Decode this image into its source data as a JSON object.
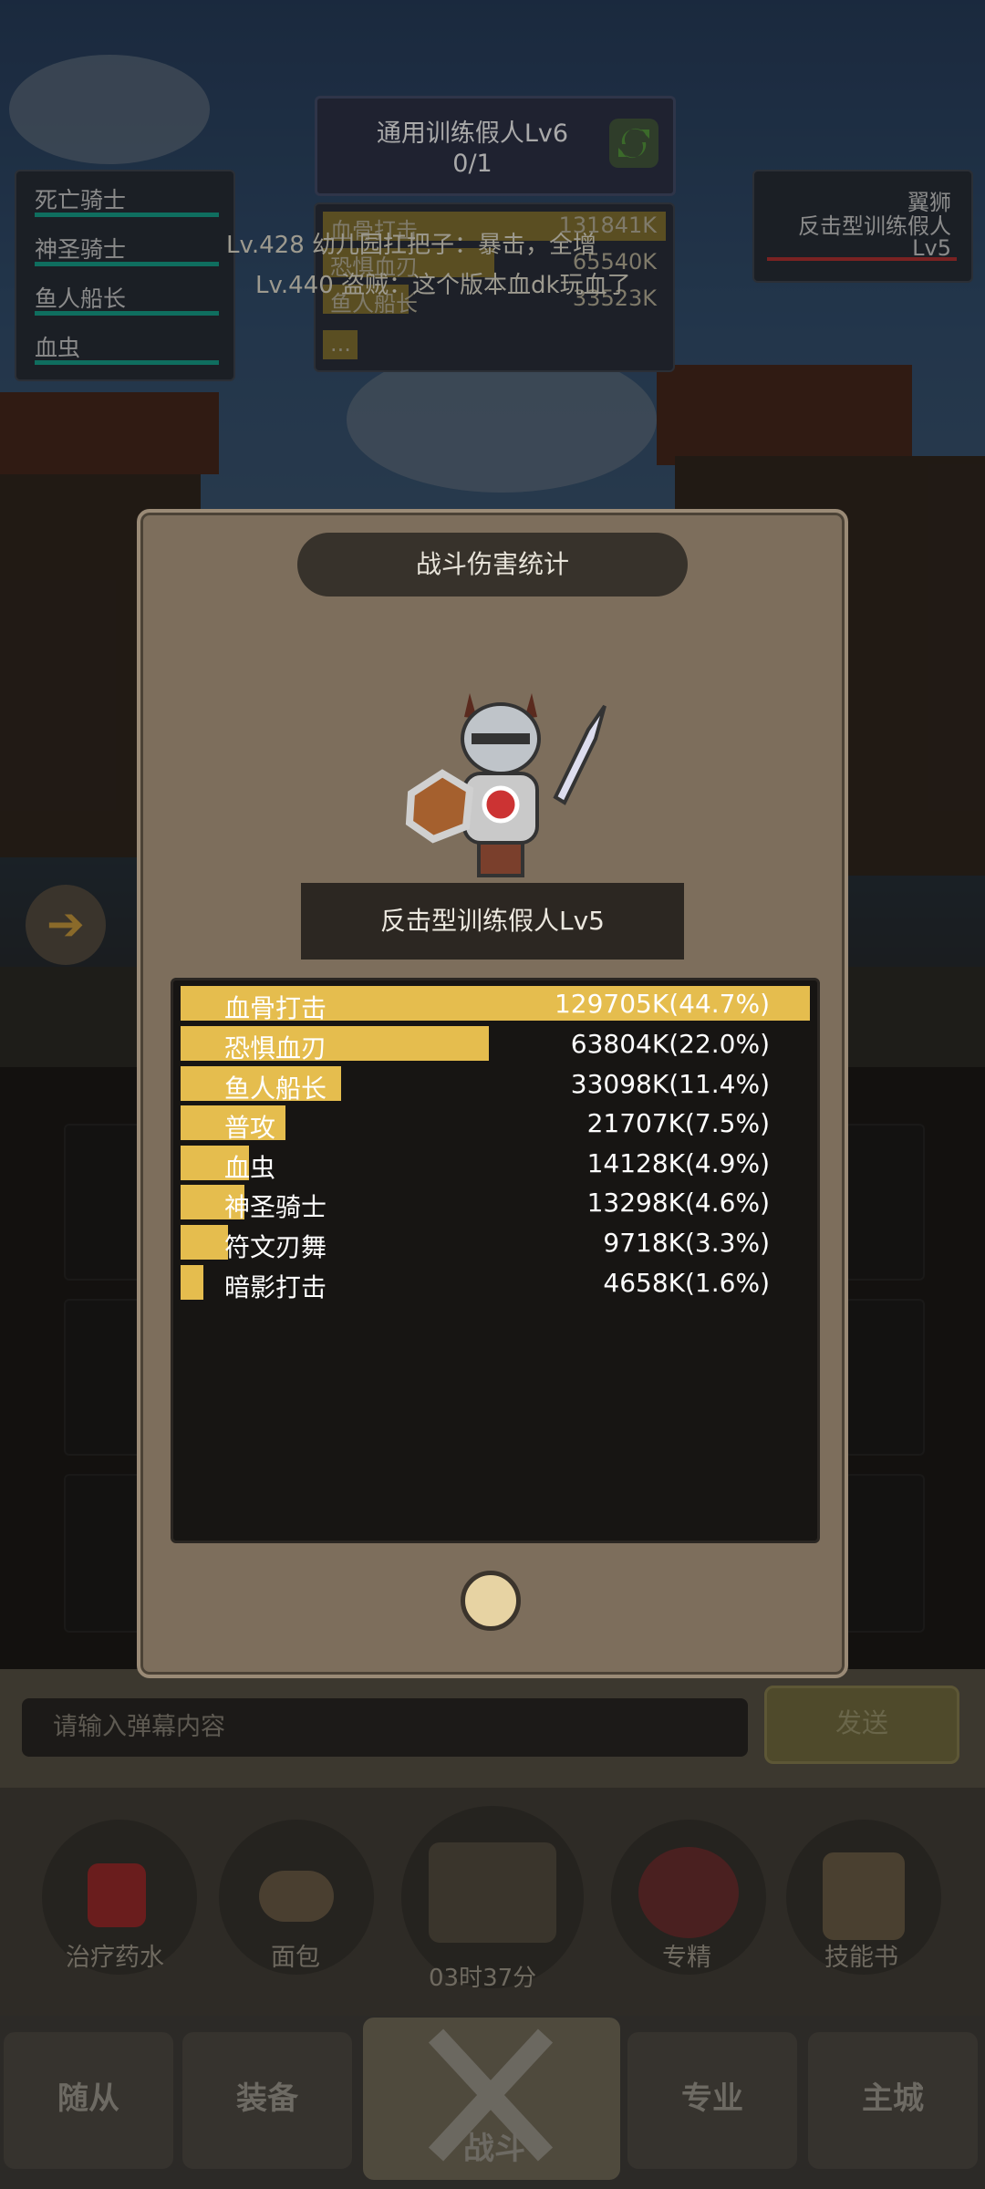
{
  "hud": {
    "target_name": "通用训练假人Lv6",
    "target_count": "0/1",
    "party": [
      {
        "label": "死亡骑士"
      },
      {
        "label": "神圣骑士"
      },
      {
        "label": "鱼人船长"
      },
      {
        "label": "血虫"
      }
    ],
    "damage_preview": [
      {
        "label": "血骨打击",
        "value": "131841K",
        "fill": 1.0
      },
      {
        "label": "恐惧血刃",
        "value": "65540K",
        "fill": 0.5
      },
      {
        "label": "鱼人船长",
        "value": "33523K",
        "fill": 0.25
      },
      {
        "label": "...",
        "value": "",
        "fill": 0.1
      }
    ],
    "enemy": {
      "name_top": "翼狮",
      "name": "反击型训练假人",
      "level": "Lv5"
    },
    "danmaku": [
      "Lv.428 幼儿园扛把子：暴击，全增",
      "Lv.440 盗贼：这个版本血dk玩血了"
    ]
  },
  "dialog": {
    "title": "战斗伤害统计",
    "target_label": "反击型训练假人Lv5",
    "rows": [
      {
        "name": "血骨打击",
        "value": "129705K(44.7%)",
        "share": 1.0
      },
      {
        "name": "恐惧血刃",
        "value": "63804K(22.0%)",
        "share": 0.49
      },
      {
        "name": "鱼人船长",
        "value": "33098K(11.4%)",
        "share": 0.255
      },
      {
        "name": "普攻",
        "value": "21707K(7.5%)",
        "share": 0.167
      },
      {
        "name": "血虫",
        "value": "14128K(4.9%)",
        "share": 0.109
      },
      {
        "name": "神圣骑士",
        "value": "13298K(4.6%)",
        "share": 0.102
      },
      {
        "name": "符文刃舞",
        "value": "9718K(3.3%)",
        "share": 0.075
      },
      {
        "name": "暗影打击",
        "value": "4658K(1.6%)",
        "share": 0.036
      }
    ]
  },
  "chat": {
    "placeholder": "请输入弹幕内容",
    "send_label": "发送"
  },
  "consumables": [
    {
      "label": "治疗药水",
      "icon": "potion-icon"
    },
    {
      "label": "面包",
      "icon": "bread-icon"
    },
    {
      "label": "",
      "icon": "chest-icon"
    },
    {
      "label": "专精",
      "icon": "spec-icon"
    },
    {
      "label": "技能书",
      "icon": "skillbook-icon"
    }
  ],
  "timer": "03时37分",
  "nav": {
    "followers": "随从",
    "equipment": "装备",
    "battle": "战斗",
    "profession": "专业",
    "main_city": "主城"
  },
  "colors": {
    "bar": "#e5bd4e",
    "panel": "#171513",
    "dialog": "#7d6e5c"
  }
}
